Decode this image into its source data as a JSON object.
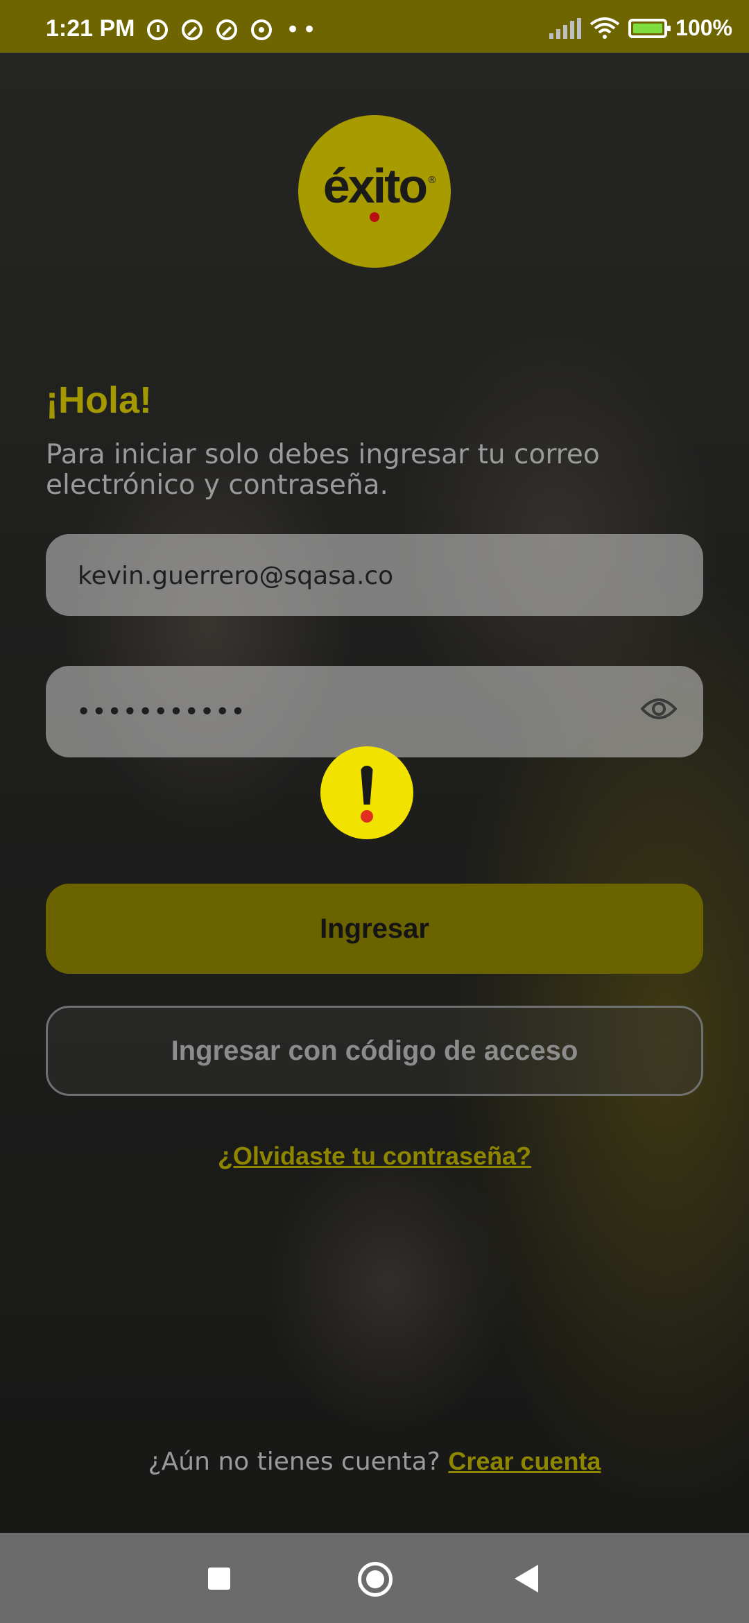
{
  "status_bar": {
    "time": "1:21 PM",
    "battery": "100%",
    "icons": [
      "alarm-icon",
      "stop-icon",
      "stop-icon",
      "chrome-icon",
      "more-dots-icon",
      "signal-icon",
      "wifi-icon",
      "battery-charging-icon"
    ]
  },
  "logo": {
    "text": "éxito",
    "registered": "®"
  },
  "greeting": "¡Hola!",
  "intro": "Para iniciar solo debes ingresar tu correo electrónico y contraseña.",
  "form": {
    "email_value": "kevin.guerrero@sqasa.co",
    "password_masked": "•••••••••••",
    "password_toggle_icon": "eye-icon"
  },
  "alert_icon": "exclamation-icon",
  "buttons": {
    "login": "Ingresar",
    "login_with_code": "Ingresar con código de acceso"
  },
  "forgot_password": "¿Olvidaste tu contraseña?",
  "signup": {
    "prompt": "¿Aún no tienes cuenta?",
    "link": "Crear cuenta"
  },
  "navbar": {
    "icons": [
      "recents-square-icon",
      "home-circle-icon",
      "back-triangle-icon"
    ]
  },
  "colors": {
    "brand_yellow": "#a79b00",
    "primary_button": "#6b6300",
    "status_bar": "#6e6500",
    "alert_yellow": "#f2e200"
  }
}
